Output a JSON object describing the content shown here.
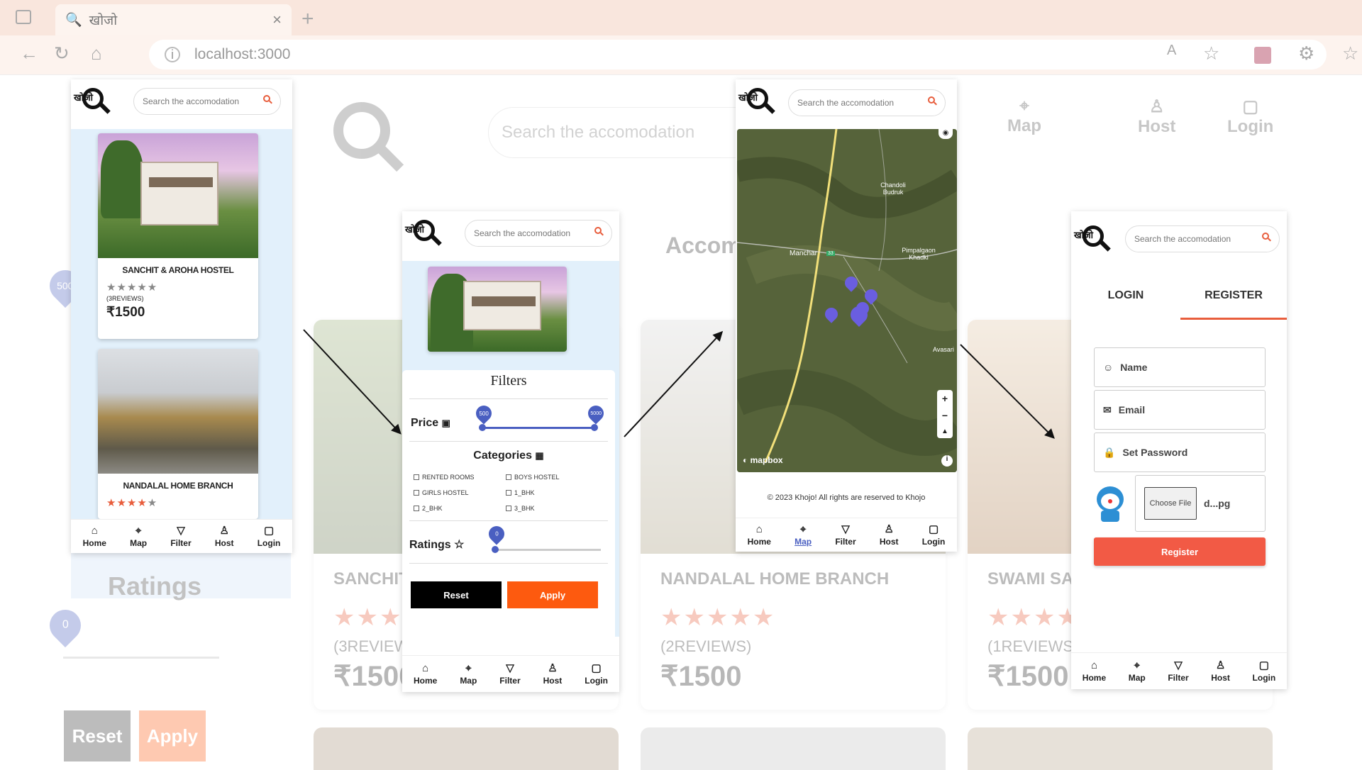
{
  "browser": {
    "tab_title": "खोजो",
    "url": "localhost:3000"
  },
  "background": {
    "search_placeholder": "Search the accomodation",
    "nav": [
      {
        "label": "Map",
        "icon": "map-pin-icon"
      },
      {
        "label": "Host",
        "icon": "user-icon"
      },
      {
        "label": "Login",
        "icon": "login-icon"
      }
    ],
    "section_title": "Accomo",
    "ratings_label": "Ratings",
    "price_knob": "500",
    "ratings_knob": "0",
    "reset_label": "Reset",
    "apply_label": "Apply",
    "cards": [
      {
        "name": "SANCHIT",
        "reviews": "(3REVIEWS",
        "price": "₹1500"
      },
      {
        "name": "NANDALAL HOME BRANCH",
        "reviews": "(2REVIEWS)",
        "price": "₹1500"
      },
      {
        "name": "SWAMI SAM",
        "reviews": "(1REVIEWS)",
        "price": "₹1500"
      }
    ]
  },
  "logo_text": "खोजो",
  "search_placeholder": "Search the accomodation",
  "bottom_nav": [
    {
      "label": "Home",
      "icon": "home-icon"
    },
    {
      "label": "Map",
      "icon": "map-pin-icon"
    },
    {
      "label": "Filter",
      "icon": "filter-icon"
    },
    {
      "label": "Host",
      "icon": "user-icon"
    },
    {
      "label": "Login",
      "icon": "login-icon"
    }
  ],
  "phone1": {
    "cards": [
      {
        "name": "SANCHIT & AROHA HOSTEL",
        "rating": 0,
        "reviews": "(3REVIEWS)",
        "price": "₹1500"
      },
      {
        "name": "NANDALAL HOME BRANCH",
        "rating": 4,
        "reviews": "",
        "price": ""
      }
    ]
  },
  "phone2": {
    "filters_title": "Filters",
    "price_label": "Price",
    "price_min": "500",
    "price_max": "5000",
    "categories_title": "Categories",
    "categories": [
      "RENTED ROOMS",
      "BOYS HOSTEL",
      "GIRLS HOSTEL",
      "1_BHK",
      "2_BHK",
      "3_BHK"
    ],
    "ratings_label": "Ratings",
    "ratings_value": "0",
    "reset_label": "Reset",
    "apply_label": "Apply"
  },
  "phone3": {
    "map_labels": [
      "Chandoli Budruk",
      "Manchar",
      "Pimpalgaon Khadki",
      "Avasari"
    ],
    "road_badge": "33",
    "attribution": "mapbox",
    "zoom_in": "+",
    "zoom_out": "−",
    "footer": "© 2023 Khojo! All rights are reserved to Khojo",
    "active_nav": "Map"
  },
  "phone4": {
    "tab_login": "LOGIN",
    "tab_register": "REGISTER",
    "name_placeholder": "Name",
    "email_placeholder": "Email",
    "password_placeholder": "Set Password",
    "choose_file": "Choose File",
    "file_name": "d...pg",
    "register_label": "Register"
  },
  "colors": {
    "accent": "#e85d3c",
    "primary": "#4a5fc1",
    "apply": "#fd5a0f"
  }
}
